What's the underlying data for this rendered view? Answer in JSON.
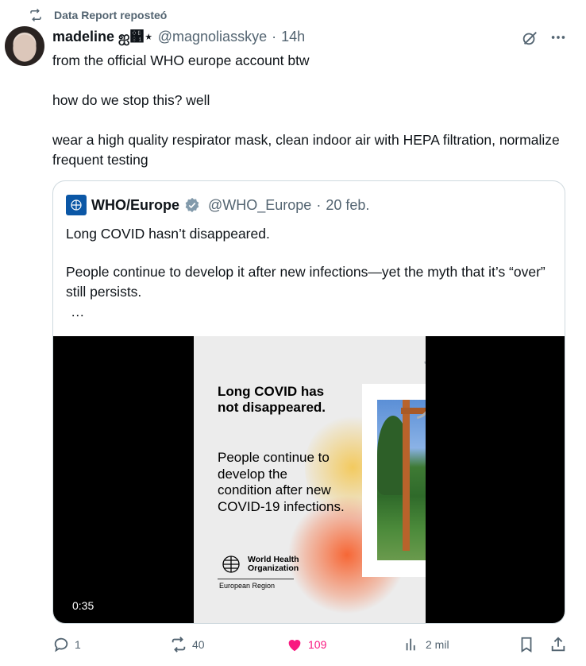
{
  "repost": {
    "label": "Data Report reposteó"
  },
  "tweet": {
    "name": "madeline ஐ஁⋆",
    "handle": "@magnoliasskye",
    "time": "14h",
    "lines": [
      "from the official WHO europe account btw",
      "how do we stop this? well",
      "wear a high quality respirator mask, clean indoor air with HEPA filtration, normalize frequent testing"
    ]
  },
  "quote": {
    "name": "WHO/Europe",
    "handle": "@WHO_Europe",
    "date": "20 feb.",
    "lines": [
      "Long COVID hasn’t disappeared.",
      "People continue to develop it after new infections—yet the myth that it’s “over” still persists.",
      "…"
    ],
    "media": {
      "headline": "Long COVID has not disappeared.",
      "subline": "People continue to develop the condition after new COVID-19 infections.",
      "org": "World Health Organization",
      "region": "European Region",
      "duration": "0:35"
    }
  },
  "actions": {
    "replies": "1",
    "reposts": "40",
    "likes": "109",
    "views": "2 mil"
  },
  "colors": {
    "like": "#f91880",
    "muted": "#536471",
    "repost_icon": "#536471"
  },
  "icons": [
    "repost-icon",
    "grok-icon",
    "more-icon",
    "verified-icon",
    "reply-icon",
    "like-icon",
    "views-icon",
    "bookmark-icon",
    "share-icon"
  ]
}
